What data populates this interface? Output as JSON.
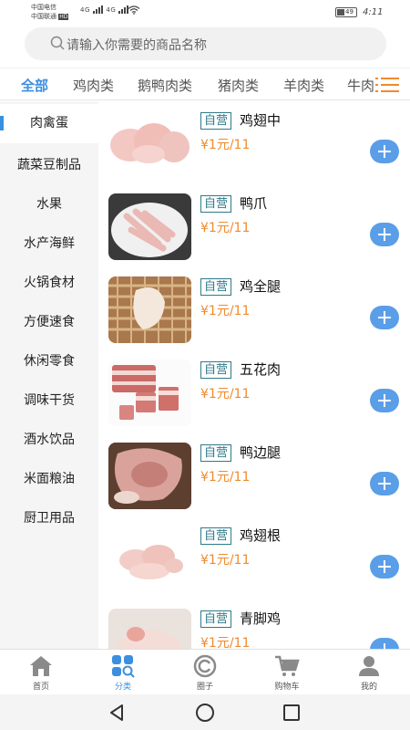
{
  "status_bar": {
    "carrier1": "中国电信",
    "carrier2": "中国联通",
    "hd": "HD",
    "net1": "4G",
    "net2": "4G",
    "battery": "49",
    "time": "4:11"
  },
  "search": {
    "placeholder": "请输入你需要的商品名称"
  },
  "tabs": [
    "全部",
    "鸡肉类",
    "鹅鸭肉类",
    "猪肉类",
    "羊肉类",
    "牛肉"
  ],
  "sidebar": [
    "肉禽蛋",
    "蔬菜豆制品",
    "水果",
    "水产海鲜",
    "火锅食材",
    "方便速食",
    "休闲零食",
    "调味干货",
    "酒水饮品",
    "米面粮油",
    "厨卫用品"
  ],
  "products": [
    {
      "badge": "自营",
      "name": "鸡翅中",
      "price": "¥1元/11"
    },
    {
      "badge": "自营",
      "name": "鸭爪",
      "price": "¥1元/11"
    },
    {
      "badge": "自营",
      "name": "鸡全腿",
      "price": "¥1元/11"
    },
    {
      "badge": "自营",
      "name": "五花肉",
      "price": "¥1元/11"
    },
    {
      "badge": "自营",
      "name": "鸭边腿",
      "price": "¥1元/11"
    },
    {
      "badge": "自营",
      "name": "鸡翅根",
      "price": "¥1元/11"
    },
    {
      "badge": "自营",
      "name": "青脚鸡",
      "price": "¥1元/11"
    }
  ],
  "bottom_nav": [
    {
      "label": "首页",
      "icon": "home-icon"
    },
    {
      "label": "分类",
      "icon": "category-icon"
    },
    {
      "label": "圈子",
      "icon": "circle-icon"
    },
    {
      "label": "购物车",
      "icon": "cart-icon"
    },
    {
      "label": "我的",
      "icon": "user-icon"
    }
  ],
  "colors": {
    "accent": "#3b8fe0",
    "price": "#f08a2c",
    "badge": "#2f7a8a",
    "add_button": "#5a9ee8"
  }
}
